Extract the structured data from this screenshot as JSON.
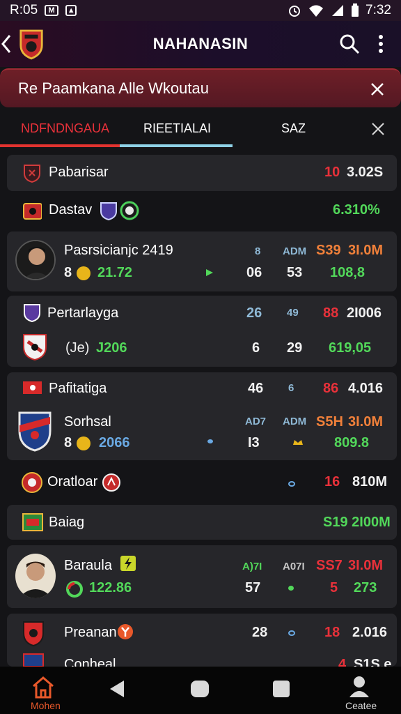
{
  "status": {
    "time_left": "R:05",
    "time_right": "7:32"
  },
  "app": {
    "title": "NAHANASIN"
  },
  "banner": {
    "text": "Re Paamkana Alle Wkoutau"
  },
  "tabs": [
    {
      "label": "NDFNDNGAUA"
    },
    {
      "label": "RIEETIALAI"
    },
    {
      "label": "SAZ"
    }
  ],
  "rows": {
    "r1": {
      "name": "Pabarisar",
      "stat": "10",
      "value": "3.02S"
    },
    "r2": {
      "name": "Dastav",
      "value": "6.310%"
    },
    "r3": {
      "name": "Pasrsicianjc 2419",
      "sub_prefix": "8",
      "sub_value": "21.72",
      "c1": "8",
      "c2": "ADM",
      "c3": "S39",
      "c4": "3I.0M",
      "c5": "06",
      "c6": "53",
      "c7": "108,8"
    },
    "r4": {
      "name": "Pertarlayga",
      "sub_text": "(Je)",
      "sub_value": "J206",
      "c1": "26",
      "c2": "49",
      "c3": "88",
      "c4": "2I006",
      "c5": "6",
      "c6": "29",
      "c7": "619,05"
    },
    "r5": {
      "name": "Pafitatiga",
      "c1": "46",
      "c2": "6",
      "c3": "86",
      "c4": "4.016"
    },
    "r6": {
      "name": "Sorhsal",
      "sub_prefix": "8",
      "sub_value": "2066",
      "c1": "AD7",
      "c2": "ADM",
      "c3": "S5H",
      "c4": "3I.0M",
      "c5": "I3",
      "c7": "809.8"
    },
    "r7": {
      "name": "Oratloar",
      "c3": "16",
      "c4": "810M"
    },
    "r8": {
      "name": "Baiag",
      "value": "S19 2I00M"
    },
    "r9": {
      "name": "Baraula",
      "sub_value": "122.86",
      "c1": "A)7I",
      "c2": "A07I",
      "c3": "SS7",
      "c4": "3I.0M",
      "c5": "57",
      "c6": "5",
      "c7": "273"
    },
    "r10": {
      "name": "Preanan",
      "c1": "28",
      "c3": "18",
      "c4": "2.016"
    },
    "r11": {
      "name": "Conheal",
      "c3": "4",
      "c4": "S1S.e"
    }
  },
  "nav": {
    "home_label": "Mohen",
    "profile_label": "Ceatee"
  },
  "colors": {
    "accent": "#e2332f",
    "positive": "#52d85a",
    "negative": "#e8313a",
    "warning": "#f0803a",
    "background": "#141417",
    "card": "#26262a"
  }
}
